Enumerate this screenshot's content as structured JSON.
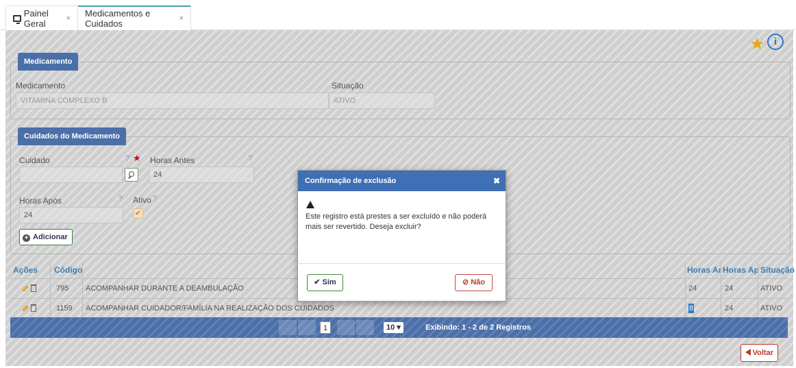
{
  "tabs": [
    {
      "label": "Painel Geral",
      "close": "×"
    },
    {
      "label": "Medicamentos e Cuidados",
      "close": "×"
    }
  ],
  "toolbar": {
    "star_icon": "★",
    "info_icon": "i"
  },
  "medicamento": {
    "title": "Medicamento",
    "med_label": "Medicamento",
    "med_value": "VITAMINA COMPLEXO B",
    "sit_label": "Situação",
    "sit_value": "ATIVO"
  },
  "cuidados": {
    "title": "Cuidados do Medicamento",
    "cuidado_label": "Cuidado",
    "horas_antes_label": "Horas Antes",
    "horas_antes_value": "24",
    "horas_apos_label": "Horas Após",
    "horas_apos_value": "24",
    "ativo_label": "Ativo",
    "help": "?",
    "required": "★",
    "add_label": "Adicionar",
    "add_icon": "+"
  },
  "grid": {
    "headers": [
      "Ações",
      "Código",
      "Horas Ant",
      "Horas Apó",
      "Situação"
    ],
    "rows": [
      {
        "codigo": "795",
        "descricao": "ACOMPANHAR DURANTE A DEAMBULAÇÃO",
        "antes": "24",
        "apos": "24",
        "situacao": "ATIVO"
      },
      {
        "codigo": "1159",
        "descricao": "ACOMPANHAR CUIDADOR/FAMÍLIA NA REALIZAÇÃO DOS CUIDADOS",
        "antes": "8",
        "apos": "24",
        "situacao": "ATIVO"
      }
    ]
  },
  "pager": {
    "current_page": "1",
    "page_size": "10 ▾",
    "info": "Exibindo: 1 - 2 de 2 Registros"
  },
  "voltar_label": "Voltar",
  "modal": {
    "title": "Confirmação de exclusão",
    "close": "✖",
    "message": "Este registro está prestes a ser excluído e não poderá mais ser revertido. Deseja excluir?",
    "yes": "✔ Sim",
    "no": "⊘ Não"
  },
  "colors": {
    "header_blue": "#4a6fa9",
    "modal_blue": "#3f6fb4",
    "tab_accent": "#4aa3a0"
  }
}
